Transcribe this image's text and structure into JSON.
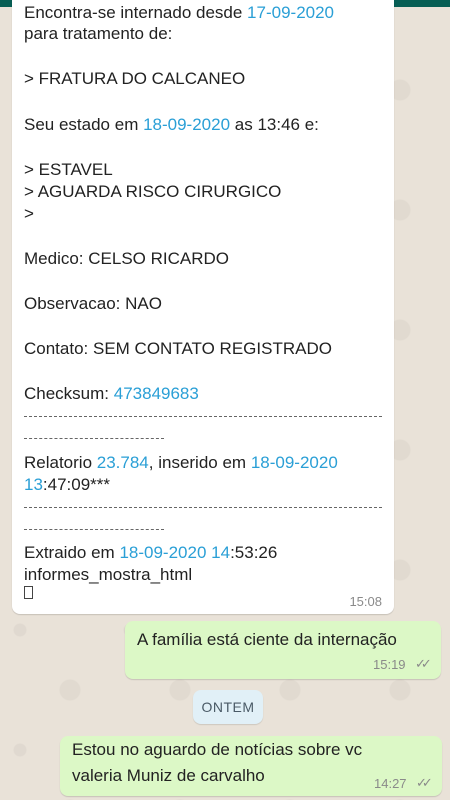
{
  "conversation": {
    "incoming_message": {
      "lines": {
        "l0_prefix": "Encontra-se internado desde ",
        "l0_date": "17-09-2020",
        "l1": "para tratamento de:",
        "l2": "> FRATURA DO CALCANEO",
        "l3_prefix": "Seu estado em ",
        "l3_date": "18-09-2020",
        "l3_suffix": " as 13:46 e:",
        "l4": "> ESTAVEL",
        "l5": "> AGUARDA RISCO CIRURGICO",
        "l6": ">",
        "l7": "Medico: CELSO RICARDO",
        "l8": "Observacao: NAO",
        "l9": "Contato: SEM CONTATO REGISTRADO",
        "l10_prefix": "Checksum: ",
        "l10_value": "473849683",
        "l11_prefix": "Relatorio ",
        "l11_number": "23.784",
        "l11_mid": ", inserido em ",
        "l11_date": "18-09-2020",
        "l12_hour": "13",
        "l12_rest": ":47:09***",
        "l13_prefix": "Extraido em ",
        "l13_date": "18-09-2020",
        "l13_space": " ",
        "l13_hour": "14",
        "l13_rest": ":53:26",
        "l14": "informes_mostra_html"
      },
      "time": "15:08"
    },
    "outgoing_message_1": {
      "text": "A família está ciente da internação",
      "time": "15:19",
      "ticks": "✓✓"
    },
    "date_separator": "ONTEM",
    "outgoing_message_2": {
      "line1": "Estou no aguardo de notícias sobre vc",
      "line2": "valeria Muniz de carvalho",
      "time": "14:27",
      "ticks": "✓✓"
    }
  },
  "colors": {
    "header": "#075e54",
    "chat_background": "#e9e2d8",
    "incoming_bubble": "#ffffff",
    "outgoing_bubble": "#dcf8c6",
    "link": "#2a9fd6",
    "date_chip": "#e1f0f7"
  }
}
